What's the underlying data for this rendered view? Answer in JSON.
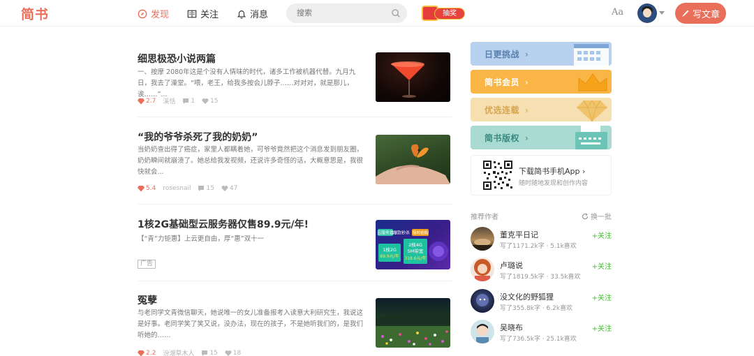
{
  "brand": {
    "logo": "简书",
    "accent": "#ea6f5a"
  },
  "nav": {
    "items": [
      {
        "label": "发现",
        "icon": "compass-icon"
      },
      {
        "label": "关注",
        "icon": "book-icon"
      },
      {
        "label": "消息",
        "icon": "bell-icon"
      }
    ]
  },
  "search": {
    "placeholder": "搜索"
  },
  "lottery": {
    "label": "抽奖"
  },
  "header": {
    "font_toggle": "Aa",
    "write_label": "写文章"
  },
  "articles": [
    {
      "title": "细思极恐小说两篇",
      "abstract": "一、按摩 2080年这是个没有人情味的时代，诸多工作被机器代替。九月九日，我去了澡堂。“喂，老王，给我多按会儿脖子……对对对，就是那儿，诶……”...",
      "diamonds": "2.7",
      "author": "溪恬",
      "comments": "1",
      "likes": "15"
    },
    {
      "title": "“我的爷爷杀死了我的奶奶”",
      "abstract": "当奶奶查出得了癌症，家里人都瞒着她，可爷爷竟然把这个消息发到朋友圈，奶奶瞬间就崩溃了。她总给我发视频，还说许多奇怪的话，大概意思是，我很快就会...",
      "diamonds": "5.4",
      "author": "rosesnail",
      "comments": "15",
      "likes": "47"
    },
    {
      "title": "1核2G基础型云服务器仅售89.9元/年!",
      "abstract": "【“青”力钜惠】上云更自由，厚“惠”双十一",
      "ad_tag": "广告",
      "ad_image": {
        "badge": "云服务器",
        "tag": "爆款秒杀",
        "hot": "限时抢购",
        "box1_top": "1核2G",
        "box1_price": "89.9元/年",
        "box2_top": "2核4G",
        "box2_mid": "5M带宽",
        "box2_price": "318.6元/年"
      }
    },
    {
      "title": "冤孽",
      "abstract": "与老同学文青微信聊天，她说唯一的女儿准备报考入读意大利研究生，我说这是好事。老同学笑了笑又说，没办法，现在的孩子，不是她听我们的，是我们听她的……",
      "diamonds": "2.2",
      "author": "汾湖草木人",
      "comments": "15",
      "likes": "18"
    }
  ],
  "sidebar": {
    "banners": [
      {
        "label": "日更挑战",
        "color": "#b7d1ee"
      },
      {
        "label": "简书会员",
        "color": "#f9b646"
      },
      {
        "label": "优选连载",
        "color": "#f6dfb1"
      },
      {
        "label": "简书版权",
        "color": "#a9dbd3"
      }
    ],
    "app": {
      "title": "下载简书手机App",
      "subtitle": "随时随地发现和创作内容"
    },
    "recommend_title": "推荐作者",
    "refresh_label": "换一批",
    "authors": [
      {
        "name": "董克平日记",
        "stats": "写了1171.2k字 · 5.1k喜欢",
        "follow": "+关注"
      },
      {
        "name": "卢璐说",
        "stats": "写了1819.5k字 · 33.5k喜欢",
        "follow": "+关注"
      },
      {
        "name": "没文化的野狐狸",
        "stats": "写了355.8k字 · 6.2k喜欢",
        "follow": "+关注"
      },
      {
        "name": "吴晓布",
        "stats": "写了736.5k字 · 25.1k喜欢",
        "follow": "+关注"
      }
    ]
  }
}
